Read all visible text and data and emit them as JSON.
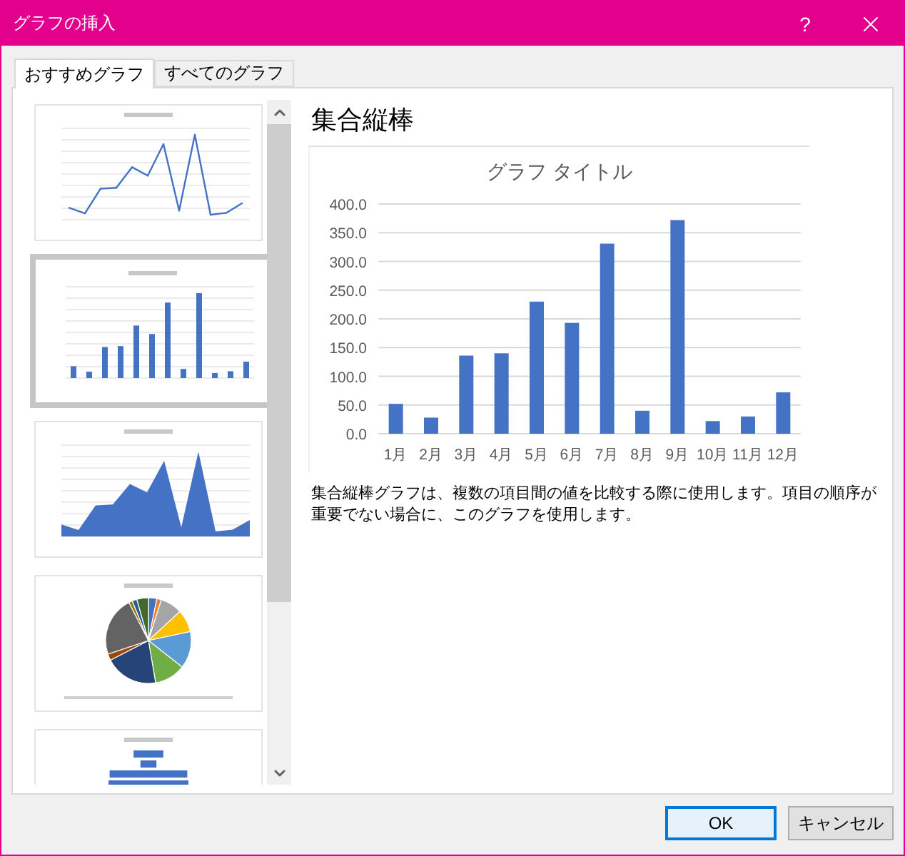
{
  "window": {
    "title": "グラフの挿入",
    "help": "?"
  },
  "tabs": [
    {
      "label": "おすすめグラフ",
      "selected": true
    },
    {
      "label": "すべてのグラフ",
      "selected": false
    }
  ],
  "thumbnails": [
    {
      "kind": "line",
      "selected": false
    },
    {
      "kind": "bar",
      "selected": true
    },
    {
      "kind": "area",
      "selected": false
    },
    {
      "kind": "pie",
      "selected": false
    },
    {
      "kind": "hbar",
      "selected": false
    }
  ],
  "preview": {
    "heading": "集合縦棒",
    "chart_data": {
      "type": "bar",
      "title": "グラフ タイトル",
      "categories": [
        "1月",
        "2月",
        "3月",
        "4月",
        "5月",
        "6月",
        "7月",
        "8月",
        "9月",
        "10月",
        "11月",
        "12月"
      ],
      "grid": true,
      "series": [
        {
          "color": "#4472c4",
          "values": [
            52,
            28,
            136,
            140,
            230,
            193,
            331,
            40,
            372,
            22,
            30,
            72
          ]
        }
      ],
      "ylim": [
        0,
        400
      ],
      "yticks": [
        {
          "value": 0,
          "label": "0.0"
        },
        {
          "value": 50,
          "label": "50.0"
        },
        {
          "value": 100,
          "label": "100.0"
        },
        {
          "value": 150,
          "label": "150.0"
        },
        {
          "value": 200,
          "label": "200.0"
        },
        {
          "value": 250,
          "label": "250.0"
        },
        {
          "value": 300,
          "label": "300.0"
        },
        {
          "value": 350,
          "label": "350.0"
        },
        {
          "value": 400,
          "label": "400.0"
        }
      ]
    },
    "description": "集合縦棒グラフは、複数の項目間の値を比較する際に使用します。項目の順序が重要でない場合に、このグラフを使用します。"
  },
  "buttons": [
    {
      "label": "OK",
      "kind": "default"
    },
    {
      "label": "キャンセル",
      "kind": "normal"
    }
  ]
}
